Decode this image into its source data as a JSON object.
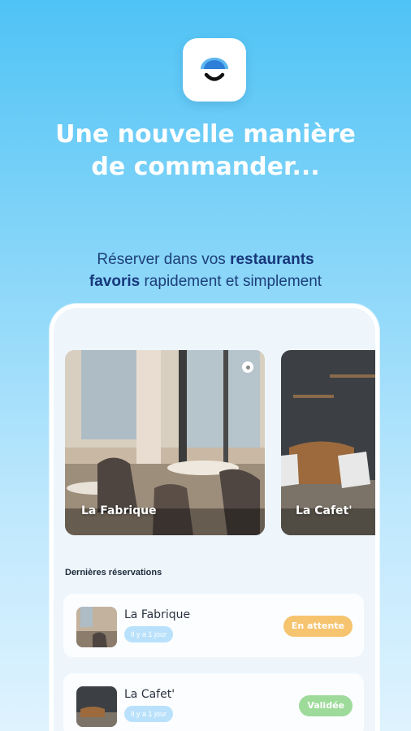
{
  "app_icon": {
    "name": "restaurant-cloche-icon"
  },
  "headline": {
    "line1": "Une nouvelle manière",
    "line2": "de commander..."
  },
  "subline": {
    "part1": "Réserver dans vos ",
    "bold1": "restaurants",
    "bold2": "favoris",
    "part2": " rapidement et simplement"
  },
  "restaurants": [
    {
      "name": "La Fabrique"
    },
    {
      "name": "La Cafet'"
    }
  ],
  "reservations": {
    "title": "Dernières réservations",
    "items": [
      {
        "name": "La Fabrique",
        "time": "Il y a 1 jour",
        "status": "En attente"
      },
      {
        "name": "La Cafet'",
        "time": "Il y a 1 jour",
        "status": "Validée"
      }
    ]
  },
  "colors": {
    "brand_blue": "#4fc3f5",
    "pending": "#f6c46f",
    "validated": "#9edb9a"
  }
}
